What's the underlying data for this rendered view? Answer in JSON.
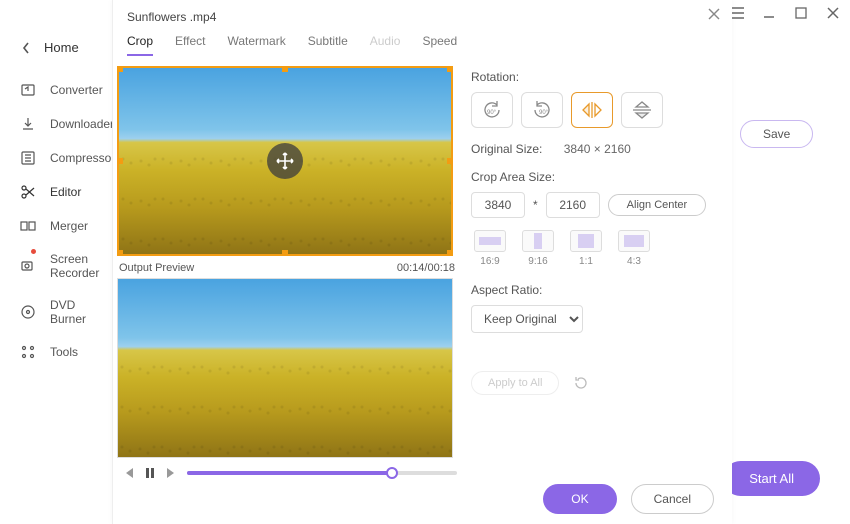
{
  "window": {
    "home_label": "Home"
  },
  "sidebar": {
    "items": [
      {
        "label": "Converter"
      },
      {
        "label": "Downloader"
      },
      {
        "label": "Compressor"
      },
      {
        "label": "Editor"
      },
      {
        "label": "Merger"
      },
      {
        "label": "Screen Recorder"
      },
      {
        "label": "DVD Burner"
      },
      {
        "label": "Tools"
      }
    ]
  },
  "right": {
    "save_label": "Save",
    "start_all_label": "Start All"
  },
  "dialog": {
    "title": "Sunflowers .mp4",
    "tabs": {
      "crop": "Crop",
      "effect": "Effect",
      "watermark": "Watermark",
      "subtitle": "Subtitle",
      "audio": "Audio",
      "speed": "Speed"
    },
    "preview_label": "Output Preview",
    "time": "00:14/00:18",
    "rotation_label": "Rotation:",
    "rotate_left_text": "90°",
    "rotate_right_text": "90°",
    "original_size_label": "Original Size:",
    "original_size_value": "3840 × 2160",
    "crop_area_label": "Crop Area Size:",
    "crop_width": "3840",
    "crop_height": "2160",
    "crop_mult": "*",
    "align_center_label": "Align Center",
    "ratios": {
      "r169": "16:9",
      "r916": "9:16",
      "r11": "1:1",
      "r43": "4:3"
    },
    "aspect_label": "Aspect Ratio:",
    "aspect_value": "Keep Original",
    "apply_all_label": "Apply to All",
    "ok_label": "OK",
    "cancel_label": "Cancel"
  }
}
